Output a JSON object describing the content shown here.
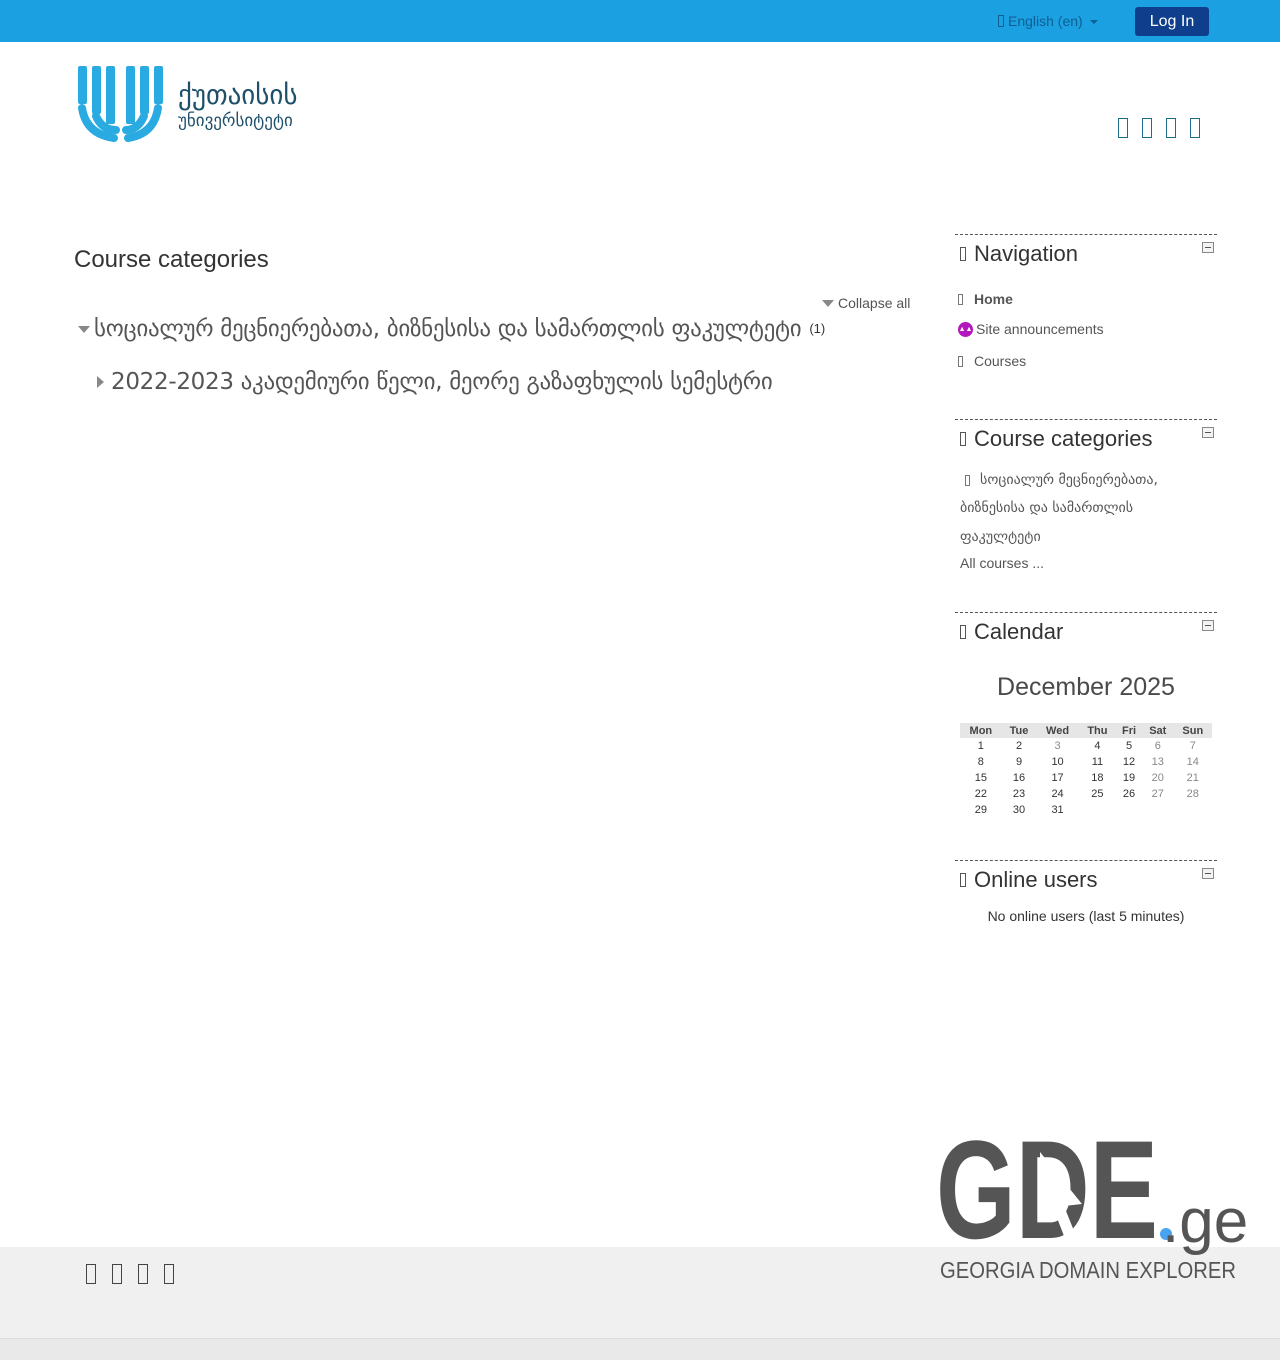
{
  "topbar": {
    "language_label": "English (en)",
    "login_label": "Log In",
    "bg_color": "#1ba0e1",
    "login_color": "#0f3f8c"
  },
  "logo": {
    "line1": "ქუთაისის",
    "line2": "უნივერსიტეტი",
    "color": "#29abe2"
  },
  "header_social_icons": [
    "social-icon",
    "social-icon",
    "social-icon",
    "social-icon"
  ],
  "main": {
    "page_title": "Course categories",
    "collapse_all_label": "Collapse all",
    "categories": [
      {
        "name": "სოციალურ მეცნიერებათა, ბიზნესისა და სამართლის ფაკულტეტი",
        "count": "(1)",
        "expanded": true,
        "children": [
          {
            "name": "2022-2023 აკადემიური წელი, მეორე გაზაფხულის სემესტრი",
            "expanded": false
          }
        ]
      }
    ]
  },
  "blocks": {
    "navigation": {
      "title": "Navigation",
      "items": [
        {
          "label": "Home",
          "icon": "nav-bullet-icon"
        },
        {
          "label": "Site announcements",
          "icon": "forum-icon"
        },
        {
          "label": "Courses",
          "icon": "nav-bullet-icon"
        }
      ]
    },
    "course_categories": {
      "title": "Course categories",
      "lines": [
        "სოციალურ მეცნიერებათა,",
        "ბიზნესისა და სამართლის",
        "ფაკულტეტი"
      ],
      "all_courses": "All courses ..."
    },
    "calendar": {
      "title": "Calendar",
      "month": "December 2025",
      "weekdays": [
        "Mon",
        "Tue",
        "Wed",
        "Thu",
        "Fri",
        "Sat",
        "Sun"
      ],
      "weeks": [
        [
          "1",
          "2",
          "3",
          "4",
          "5",
          "6",
          "7"
        ],
        [
          "8",
          "9",
          "10",
          "11",
          "12",
          "13",
          "14"
        ],
        [
          "15",
          "16",
          "17",
          "18",
          "19",
          "20",
          "21"
        ],
        [
          "22",
          "23",
          "24",
          "25",
          "26",
          "27",
          "28"
        ],
        [
          "29",
          "30",
          "31",
          "",
          "",
          "",
          ""
        ]
      ]
    },
    "online_users": {
      "title": "Online users",
      "text": "No online users (last 5 minutes)"
    }
  },
  "watermark": {
    "brand": "GDE",
    "tld": ".ge",
    "tagline": "GEORGIA DOMAIN EXPLORER"
  },
  "footer_social_icons": [
    "social-icon",
    "social-icon",
    "social-icon",
    "social-icon"
  ]
}
